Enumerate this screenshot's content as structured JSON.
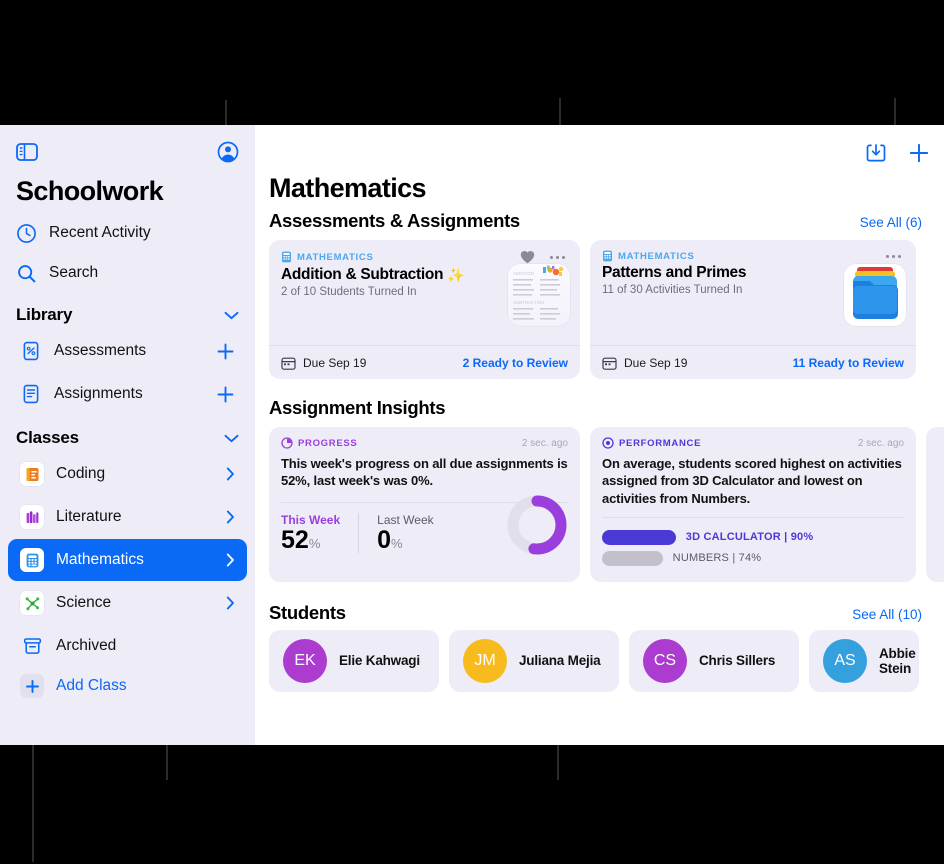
{
  "sidebar": {
    "toggle_icon": "sidebar-toggle-icon",
    "account_icon": "account-circle-icon",
    "title": "Schoolwork",
    "nav": [
      {
        "label": "Recent Activity",
        "icon": "clock-icon"
      },
      {
        "label": "Search",
        "icon": "search-icon"
      }
    ],
    "library": {
      "label": "Library",
      "items": [
        {
          "label": "Assessments",
          "icon": "percent-doc-icon",
          "action": "add-assessment"
        },
        {
          "label": "Assignments",
          "icon": "lines-doc-icon",
          "action": "add-assignment"
        }
      ]
    },
    "classes": {
      "label": "Classes",
      "items": [
        {
          "label": "Coding",
          "icon": "coding-app-icon",
          "selected": false
        },
        {
          "label": "Literature",
          "icon": "literature-app-icon",
          "selected": false
        },
        {
          "label": "Mathematics",
          "icon": "calculator-app-icon",
          "selected": true
        },
        {
          "label": "Science",
          "icon": "science-app-icon",
          "selected": false
        },
        {
          "label": "Archived",
          "icon": "archive-box-icon",
          "selected": false
        }
      ],
      "add_class": "Add Class"
    }
  },
  "toolbar": {
    "import_icon": "import-download-icon",
    "add_icon": "plus-icon"
  },
  "main": {
    "page_title": "Mathematics",
    "assessments": {
      "heading": "Assessments & Assignments",
      "see_all": "See All (6)",
      "cards": [
        {
          "tag": "MATHEMATICS",
          "title": "Addition & Subtraction",
          "title_emoji": "✨",
          "subtitle": "2 of 10 Students Turned In",
          "due": "Due Sep 19",
          "ready": "2 Ready to Review",
          "favorite": true
        },
        {
          "tag": "MATHEMATICS",
          "title": "Patterns and Primes",
          "title_emoji": "",
          "subtitle": "11 of 30 Activities Turned In",
          "due": "Due Sep 19",
          "ready": "11 Ready to Review",
          "favorite": false
        }
      ]
    },
    "insights": {
      "heading": "Assignment Insights",
      "progress": {
        "tag": "PROGRESS",
        "time": "2 sec. ago",
        "body": "This week's progress on all due assignments is 52%, last week's was 0%.",
        "this_week_label": "This Week",
        "this_week_value": "52",
        "last_week_label": "Last Week",
        "last_week_value": "0",
        "percent_sign": "%",
        "ring_percent": 52,
        "accent": "#9b3ede"
      },
      "performance": {
        "tag": "PERFORMANCE",
        "time": "2 sec. ago",
        "body": "On average, students scored highest on activities assigned from 3D Calculator and lowest on activities from Numbers.",
        "bars": [
          {
            "name": "3D CALCULATOR",
            "sep": "|",
            "value": "90%",
            "pct": 90,
            "color": "#4b39d6"
          },
          {
            "name": "NUMBERS",
            "sep": "|",
            "value": "74%",
            "pct": 74,
            "color": "#c2c0cb"
          }
        ]
      }
    },
    "students": {
      "heading": "Students",
      "see_all": "See All (10)",
      "list": [
        {
          "initials": "EK",
          "name": "Elie Kahwagi",
          "color": "#ab3ccf"
        },
        {
          "initials": "JM",
          "name": "Juliana Mejia",
          "color": "#f7bb1e"
        },
        {
          "initials": "CS",
          "name": "Chris Sillers",
          "color": "#ab3ccf"
        },
        {
          "initials": "AS",
          "name": "Abbie Stein",
          "color": "#34a0dd"
        }
      ]
    }
  }
}
